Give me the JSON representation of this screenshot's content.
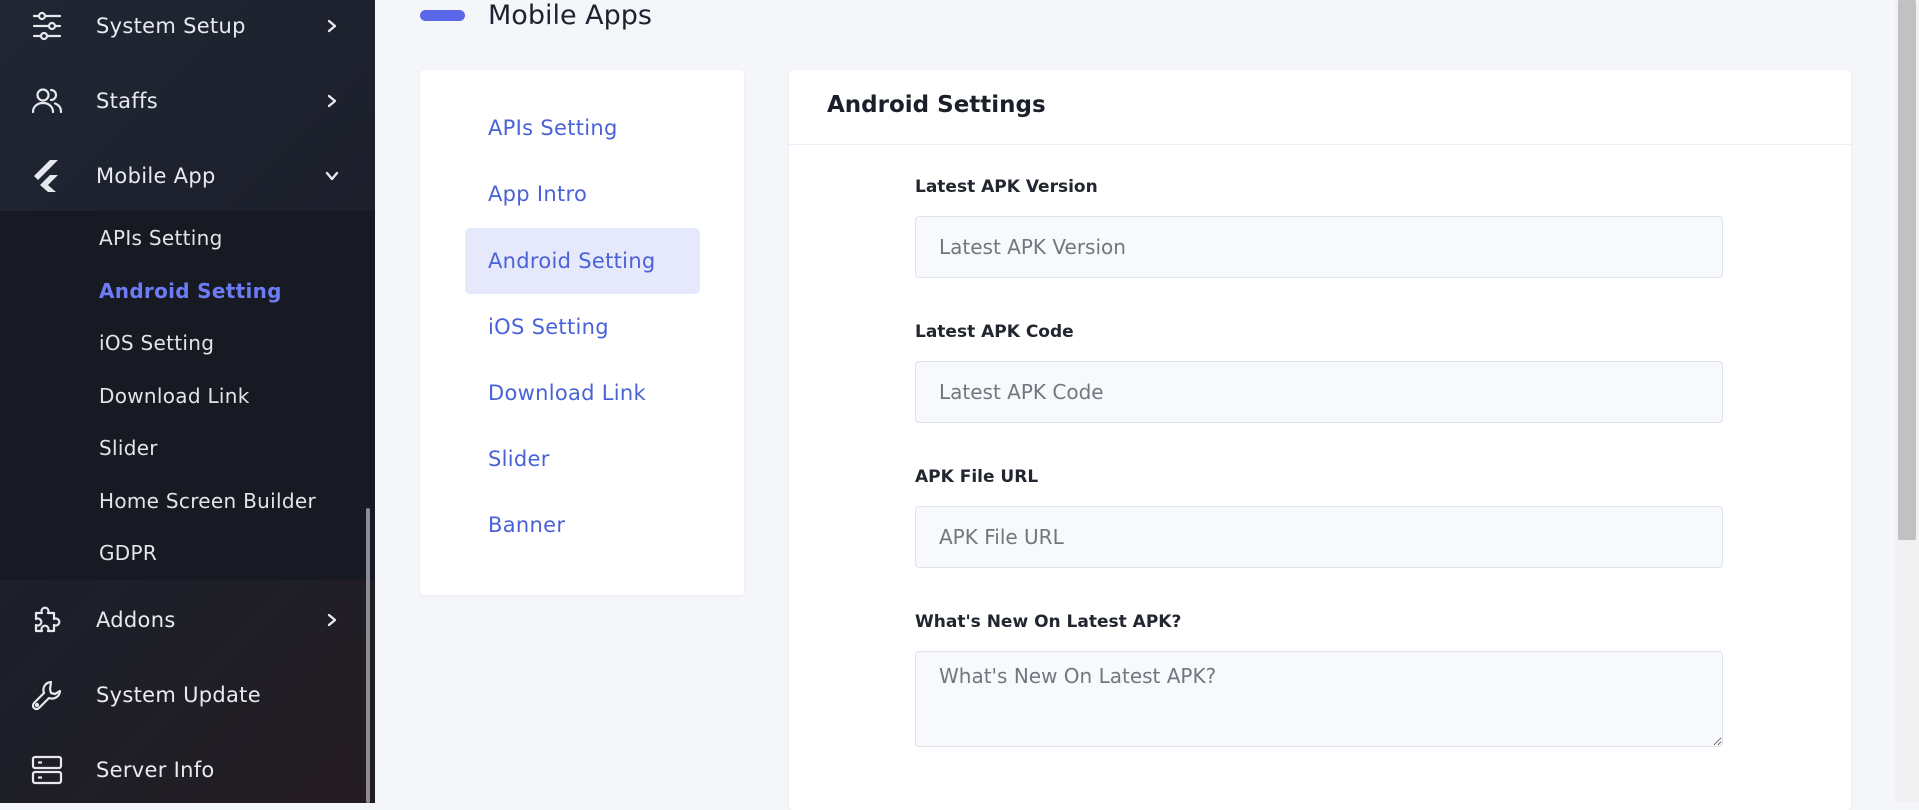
{
  "sidebar": {
    "items": [
      {
        "label": "System Setup",
        "icon": "sliders-icon"
      },
      {
        "label": "Staffs",
        "icon": "users-icon"
      },
      {
        "label": "Mobile App",
        "icon": "flutter-icon"
      },
      {
        "label": "Addons",
        "icon": "puzzle-icon"
      },
      {
        "label": "System Update",
        "icon": "wrench-icon"
      },
      {
        "label": "Server Info",
        "icon": "server-icon"
      }
    ],
    "submenu": [
      "APIs Setting",
      "Android Setting",
      "iOS Setting",
      "Download Link",
      "Slider",
      "Home Screen Builder",
      "GDPR"
    ],
    "active_submenu": "Android Setting"
  },
  "page": {
    "title": "Mobile Apps"
  },
  "tabs": [
    "APIs Setting",
    "App Intro",
    "Android Setting",
    "iOS Setting",
    "Download Link",
    "Slider",
    "Banner"
  ],
  "active_tab": "Android Setting",
  "form": {
    "title": "Android Settings",
    "fields": [
      {
        "label": "Latest APK Version",
        "placeholder": "Latest APK Version",
        "value": ""
      },
      {
        "label": "Latest APK Code",
        "placeholder": "Latest APK Code",
        "value": ""
      },
      {
        "label": "APK File URL",
        "placeholder": "APK File URL",
        "value": ""
      },
      {
        "label": "What's New On Latest APK?",
        "placeholder": "What's New On Latest APK?",
        "value": ""
      }
    ]
  },
  "colors": {
    "accent": "#5a67e8",
    "active_link": "#6c7cf5",
    "tab_text": "#4a62d8",
    "tab_active_bg": "#e6e9fc"
  }
}
